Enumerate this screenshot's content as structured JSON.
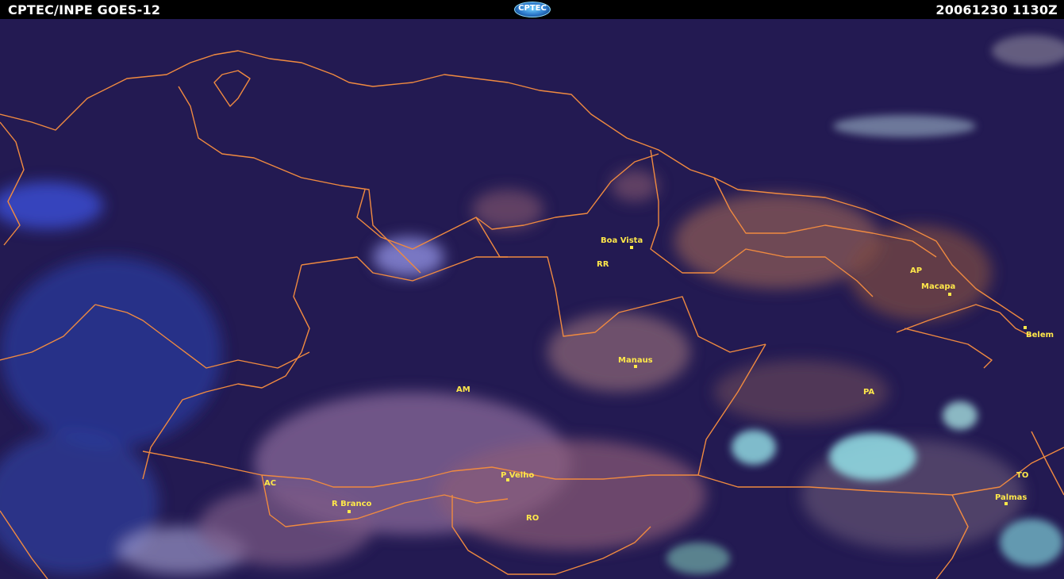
{
  "header": {
    "left_title": "CPTEC/INPE GOES-12",
    "logo_text": "CPTEC",
    "timestamp": "20061230  1130Z"
  },
  "colors": {
    "background": "#231a52",
    "border_lines": "#f08a40",
    "labels": "#ffe84a"
  },
  "map": {
    "states": [
      "RR",
      "AP",
      "AM",
      "PA",
      "AC",
      "RO",
      "TO"
    ],
    "cities": [
      "Boa Vista",
      "Macapa",
      "Belem",
      "Manaus",
      "P Velho",
      "R Branco",
      "Palmas"
    ]
  }
}
